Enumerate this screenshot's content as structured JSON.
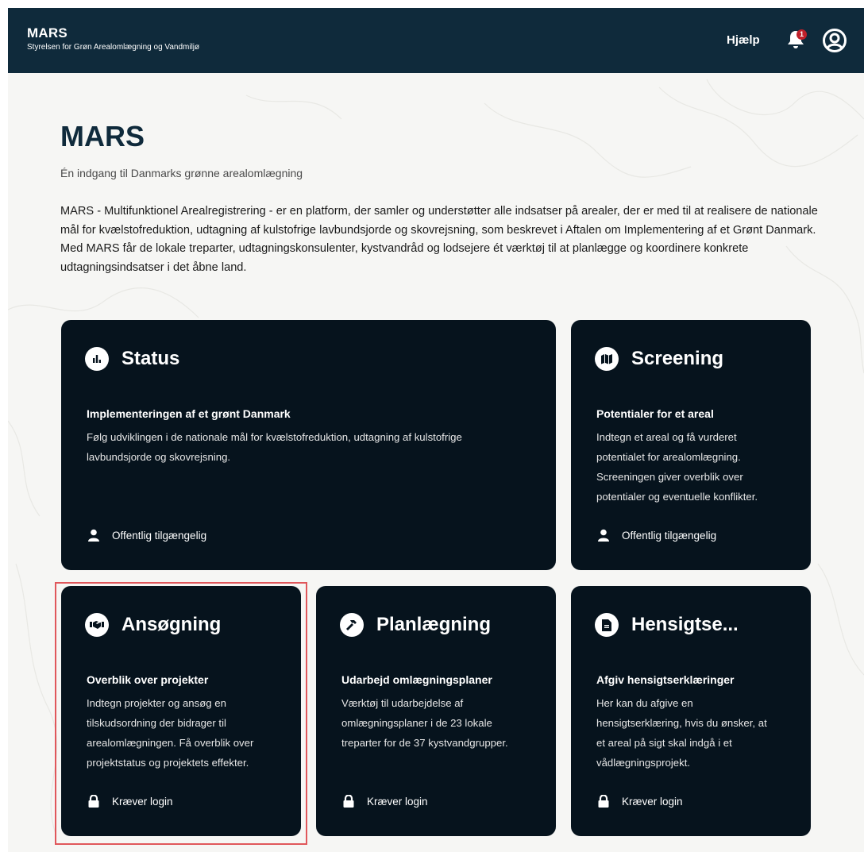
{
  "header": {
    "app_name": "MARS",
    "agency": "Styrelsen for Grøn Arealomlægning og Vandmiljø",
    "help_label": "Hjælp",
    "notification_count": "1",
    "bell_icon": "bell-icon",
    "account_icon": "user-circle-icon"
  },
  "hero": {
    "title": "MARS",
    "subtitle": "Én indgang til Danmarks grønne arealomlægning",
    "description": "MARS - Multifunktionel Arealregistrering - er en platform, der samler og understøtter alle indsatser på arealer, der er med til at realisere de nationale mål for kvælstofreduktion, udtagning af kulstofrige lavbundsjorde og skovrejsning, som beskrevet i Aftalen om Implementering af et Grønt Danmark. Med MARS får de lokale treparter, udtagningskonsulenter, kystvandråd og lodsejere ét værktøj til at planlægge og koordinere konkrete udtagningsindsatser i det åbne land."
  },
  "cards": [
    {
      "title": "Status",
      "icon": "bar-chart-icon",
      "subtitle": "Implementeringen af et grønt Danmark",
      "description": "Følg udviklingen i de nationale mål for kvælstofreduktion, udtagning af kulstofrige\nlavbundsjorde og skovrejsning.",
      "access": "Offentlig tilgængelig",
      "access_icon": "user-icon"
    },
    {
      "title": "Screening",
      "icon": "map-icon",
      "subtitle": "Potentialer for et areal",
      "description": "Indtegn et areal og få vurderet\npotentialet for arealomlægning.\nScreeningen giver overblik over\npotentialer og eventuelle konflikter.",
      "access": "Offentlig tilgængelig",
      "access_icon": "user-icon"
    },
    {
      "title": "Ansøgning",
      "icon": "handshake-icon",
      "subtitle": "Overblik over projekter",
      "description": "Indtegn projekter og ansøg en\ntilskudsordning der bidrager til\narealomlægningen. Få overblik over\nprojektstatus og projektets effekter.",
      "access": "Kræver login",
      "access_icon": "lock-icon"
    },
    {
      "title": "Planlægning",
      "icon": "hammer-icon",
      "subtitle": "Udarbejd omlægningsplaner",
      "description": "Værktøj til udarbejdelse af\nomlægningsplaner i de 23 lokale\ntreparter for de 37 kystvandgrupper.",
      "access": "Kræver login",
      "access_icon": "lock-icon"
    },
    {
      "title": "Hensigtse...",
      "icon": "document-icon",
      "subtitle": "Afgiv hensigtserklæringer",
      "description": "Her kan du afgive en\nhensigtserklæring, hvis du ønsker, at\net areal på sigt skal indgå i et\nvådlægningsprojekt.",
      "access": "Kræver login",
      "access_icon": "lock-icon"
    }
  ],
  "colors": {
    "header_bg": "#0f2a3b",
    "card_bg": "#06131d",
    "page_bg": "#f6f6f4",
    "badge": "#c0202a",
    "highlight": "#e0575b"
  }
}
